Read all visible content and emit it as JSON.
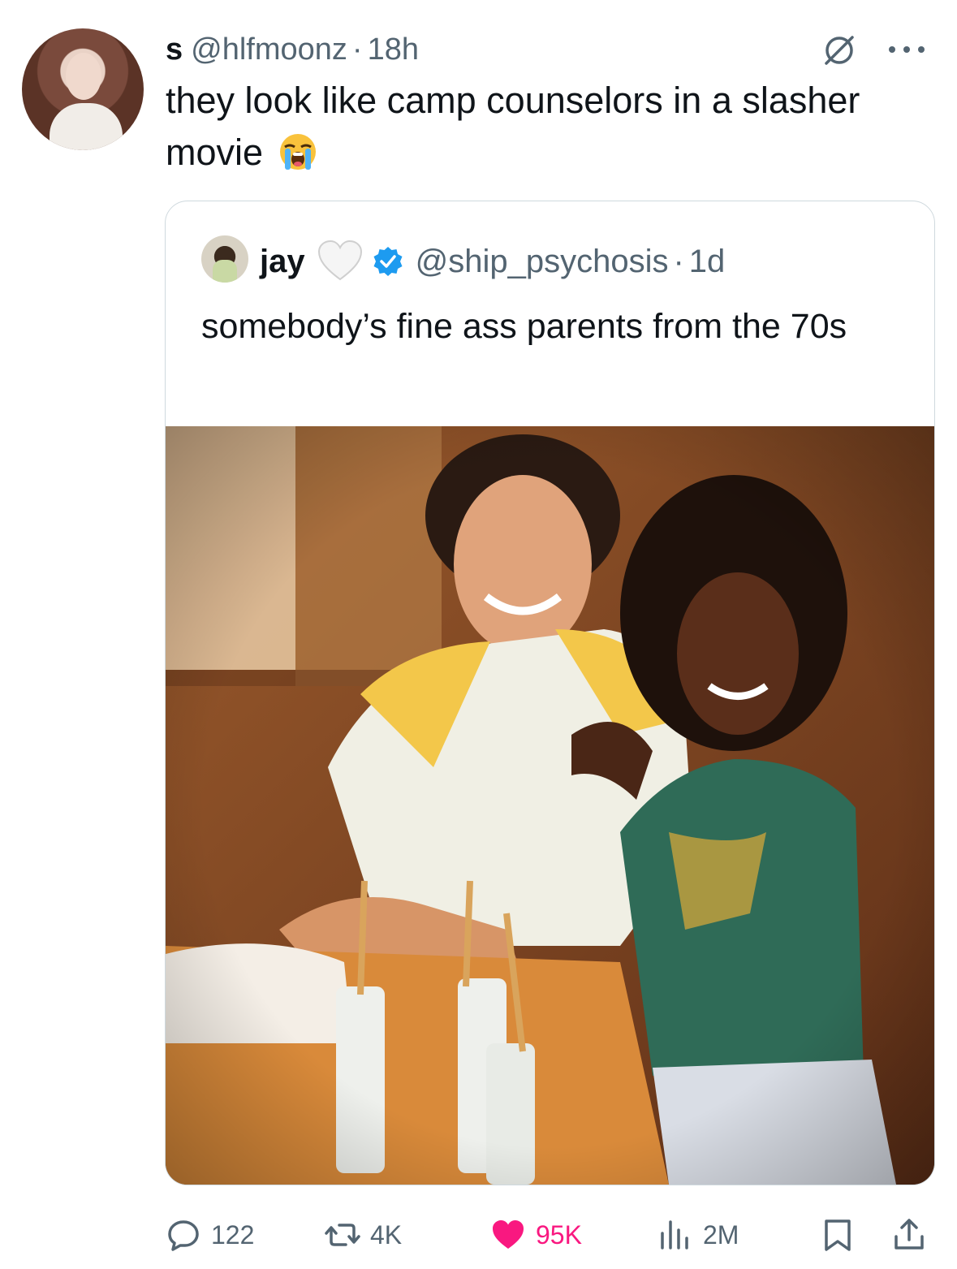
{
  "tweet": {
    "display_name": "s",
    "handle": "@hlfmoonz",
    "separator": "·",
    "time": "18h",
    "text": "they look like camp counselors in a slasher movie",
    "emoji": "loudly-crying-face"
  },
  "quoted": {
    "display_name": "jay",
    "name_emoji": "white-heart",
    "verified": true,
    "handle": "@ship_psychosis",
    "separator": "·",
    "time": "1d",
    "text": "somebody’s fine ass parents from the 70s"
  },
  "actions": {
    "replies": "122",
    "reposts": "4K",
    "likes": "95K",
    "views": "2M"
  },
  "colors": {
    "accent": "#1d9bf0",
    "like": "#f91880",
    "muted": "#536471",
    "text": "#0f1419",
    "border": "#cfd9de"
  }
}
